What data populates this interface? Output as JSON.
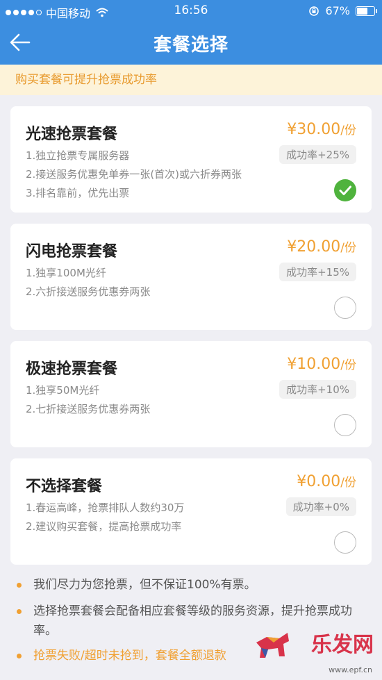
{
  "status_bar": {
    "carrier": "中国移动",
    "time": "16:56",
    "battery": "67%",
    "battery_level": 0.67
  },
  "header": {
    "title": "套餐选择"
  },
  "banner": {
    "text": "购买套餐可提升抢票成功率"
  },
  "packages": [
    {
      "title": "光速抢票套餐",
      "price": "¥30.00",
      "unit": "/份",
      "rate": "成功率+25%",
      "selected": true,
      "lines": [
        "1.独立抢票专属服务器",
        "2.接送服务优惠免单券一张(首次)或六折券两张",
        "3.排名靠前，优先出票"
      ]
    },
    {
      "title": "闪电抢票套餐",
      "price": "¥20.00",
      "unit": "/份",
      "rate": "成功率+15%",
      "selected": false,
      "lines": [
        "1.独享100M光纤",
        "2.六折接送服务优惠券两张"
      ]
    },
    {
      "title": "极速抢票套餐",
      "price": "¥10.00",
      "unit": "/份",
      "rate": "成功率+10%",
      "selected": false,
      "lines": [
        "1.独享50M光纤",
        "2.七折接送服务优惠券两张"
      ]
    },
    {
      "title": "不选择套餐",
      "price": "¥0.00",
      "unit": "/份",
      "rate": "成功率+0%",
      "selected": false,
      "lines": [
        "1.春运高峰，抢票排队人数约30万",
        "2.建议购买套餐，提高抢票成功率"
      ]
    }
  ],
  "notes": [
    {
      "text": "我们尽力为您抢票，但不保证100%有票。",
      "color": "#555555"
    },
    {
      "text": "选择抢票套餐会配备相应套餐等级的服务资源，提升抢票成功率。",
      "color": "#555555"
    },
    {
      "text": "抢票失败/超时未抢到，套餐全额退款",
      "color": "#f0a032"
    }
  ],
  "watermark": {
    "text": "乐发网",
    "url": "www.epf.cn"
  },
  "colors": {
    "accent": "#3c8ee0",
    "price": "#f0a032",
    "check": "#4fb33d"
  }
}
